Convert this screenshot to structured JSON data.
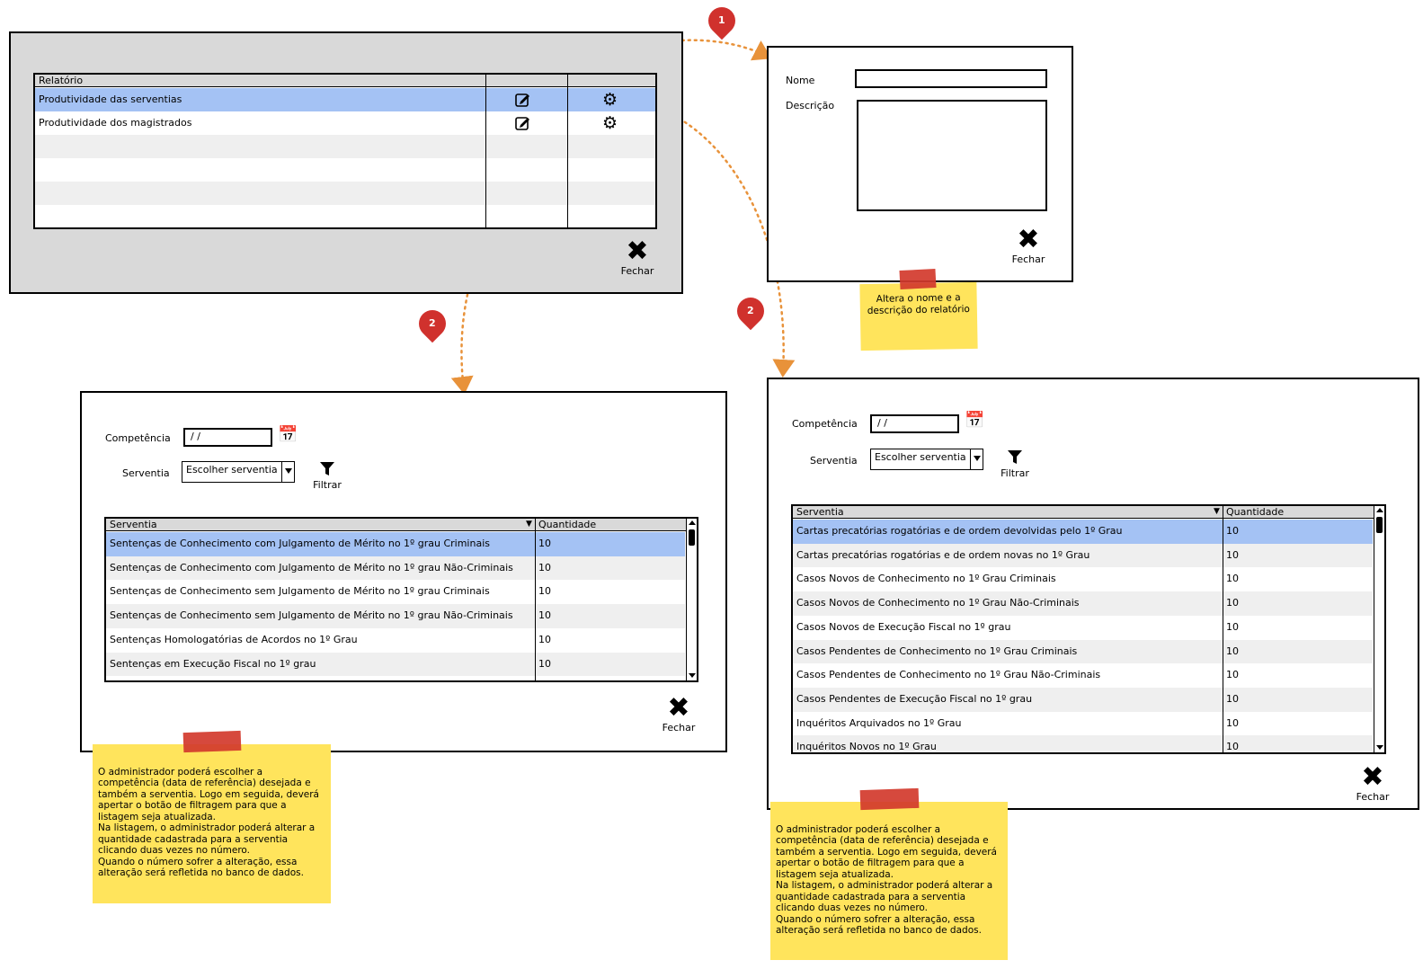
{
  "report_list": {
    "header": "Relatório",
    "rows": [
      {
        "label": "Produtividade das serventias",
        "selected": true
      },
      {
        "label": "Produtividade dos magistrados",
        "selected": false
      }
    ],
    "close_label": "Fechar",
    "close_symbol": "✖"
  },
  "edit_dialog": {
    "name_label": "Nome",
    "description_label": "Descrição",
    "close_label": "Fechar",
    "close_symbol": "✖"
  },
  "edit_note": "Altera o nome e a descrição do relatório",
  "markers": {
    "one": "1",
    "two_left": "2",
    "two_right": "2"
  },
  "filter_dialog_left": {
    "competencia_label": "Competência",
    "competencia_value": " / /",
    "serventia_label": "Serventia",
    "serventia_value": "Escolher serventia",
    "filter_label": "Filtrar",
    "col_serventia": "Serventia",
    "col_quantidade": "Quantidade",
    "rows": [
      {
        "name": "Sentenças de Conhecimento com Julgamento de Mérito no 1º grau Criminais",
        "qty": "10"
      },
      {
        "name": "Sentenças de Conhecimento com Julgamento de Mérito no 1º grau Não-Criminais",
        "qty": "10"
      },
      {
        "name": "Sentenças de Conhecimento sem Julgamento de Mérito no 1º grau Criminais",
        "qty": "10"
      },
      {
        "name": "Sentenças de Conhecimento sem Julgamento de Mérito no 1º grau Não-Criminais",
        "qty": "10"
      },
      {
        "name": "Sentenças Homologatórias de Acordos no 1º Grau",
        "qty": "10"
      },
      {
        "name": "Sentenças em Execução Fiscal no 1º grau",
        "qty": "10"
      }
    ],
    "close_label": "Fechar",
    "close_symbol": "✖"
  },
  "filter_dialog_right": {
    "competencia_label": "Competência",
    "competencia_value": " / /",
    "serventia_label": "Serventia",
    "serventia_value": "Escolher serventia",
    "filter_label": "Filtrar",
    "col_serventia": "Serventia",
    "col_quantidade": "Quantidade",
    "rows": [
      {
        "name": "Cartas precatórias rogatórias e de ordem devolvidas pelo 1º Grau",
        "qty": "10"
      },
      {
        "name": "Cartas precatórias rogatórias e de ordem novas no 1º Grau",
        "qty": "10"
      },
      {
        "name": "Casos Novos de Conhecimento no 1º Grau Criminais",
        "qty": "10"
      },
      {
        "name": "Casos Novos de Conhecimento no 1º Grau Não-Criminais",
        "qty": "10"
      },
      {
        "name": "Casos Novos de Execução Fiscal no 1º grau",
        "qty": "10"
      },
      {
        "name": "Casos Pendentes de Conhecimento no 1º Grau Criminais",
        "qty": "10"
      },
      {
        "name": "Casos Pendentes de Conhecimento no 1º Grau Não-Criminais",
        "qty": "10"
      },
      {
        "name": "Casos Pendentes de Execução Fiscal no 1º grau",
        "qty": "10"
      },
      {
        "name": "Inquéritos Arquivados no 1º Grau",
        "qty": "10"
      },
      {
        "name": "Inquéritos Novos no 1º Grau",
        "qty": "10"
      }
    ],
    "close_label": "Fechar",
    "close_symbol": "✖"
  },
  "filter_note": "O administrador poderá escolher a competência (data de referência) desejada e também a serventia. Logo em seguida, deverá apertar o botão de filtragem para que a listagem seja atualizada.\nNa listagem, o administrador poderá alterar a quantidade cadastrada para a serventia clicando duas vezes no número.\nQuando o número sofrer a alteração, essa alteração será refletida no banco de dados.",
  "colors": {
    "selected_row": "#a4c2f4",
    "note_yellow": "#ffe45c",
    "tape_red": "#d33a2c",
    "connector": "#e8923a",
    "marker": "#d0312d"
  }
}
